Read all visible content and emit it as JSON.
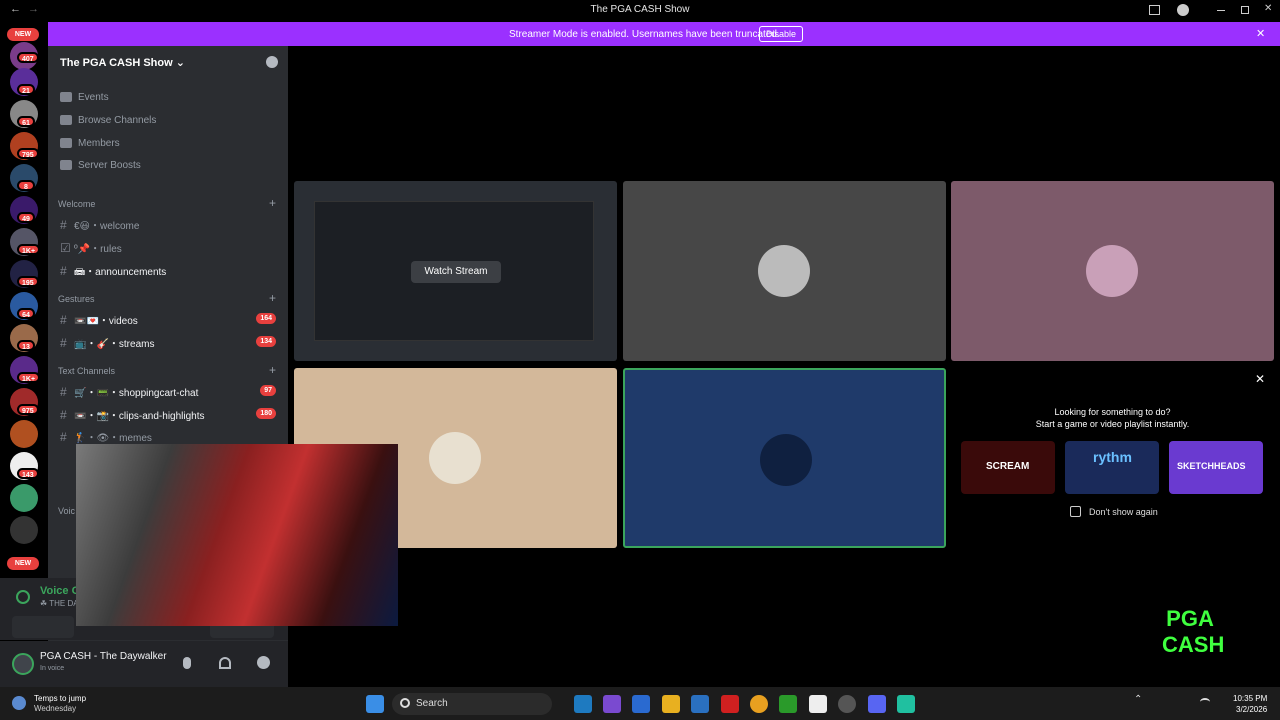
{
  "window": {
    "title": "The PGA CASH Show",
    "back": "←",
    "forward": "→"
  },
  "banner": {
    "message": "Streamer Mode is enabled. Usernames have been truncated.",
    "disable": "Disable",
    "close": "✕"
  },
  "rail": {
    "new_top": "NEW",
    "new_bottom": "NEW",
    "badges": [
      "407",
      "21",
      "61",
      "795",
      "8",
      "49",
      "1K+",
      "195",
      "64",
      "13",
      "1K+",
      "975",
      "143"
    ]
  },
  "server": {
    "name": "The PGA CASH Show",
    "chevron": "⌄"
  },
  "nav": [
    "Events",
    "Browse Channels",
    "Members",
    "Server Boosts"
  ],
  "categories": {
    "welcome": "Welcome",
    "gestures": "Gestures",
    "text": "Text Channels",
    "voice": "Voic"
  },
  "channels": {
    "welcome": "€😃・welcome",
    "rules": "º📌・rules",
    "announcements": "📾・announcements",
    "videos": "📼💌・videos",
    "videos_count": "164",
    "streams": "📺・🎸・streams",
    "streams_count": "134",
    "shopping": "🛒・📟・shoppingcart-chat",
    "shopping_count": "97",
    "clips": "📼・📸・clips-and-highlights",
    "clips_count": "180",
    "memes": "🏌・👁・memes"
  },
  "voice_panel": {
    "title": "Voice Co",
    "sub": "☘ THE DAY"
  },
  "user": {
    "name": "PGA CASH - The Daywalker",
    "status": "In voice"
  },
  "stage": {
    "watch_stream": "Watch Stream",
    "promo_title": "Looking for something to do?",
    "promo_sub": "Start a game or video playlist instantly.",
    "dont_show": "Don't show again",
    "close": "✕",
    "games": [
      "SCREAM",
      "rythm",
      "SKETCHHEADS"
    ]
  },
  "overlay": {
    "logo": "PGA CASH"
  },
  "taskbar": {
    "weather_title": "Temps to jump",
    "weather_sub": "Wednesday",
    "search": "Search",
    "time": "10:35 PM",
    "date": "3/2/2026"
  },
  "colors": {
    "banner": "#9b30ff",
    "sidebar": "#2b2d31",
    "active_border": "#3ba55c",
    "badge": "#e8403e"
  }
}
